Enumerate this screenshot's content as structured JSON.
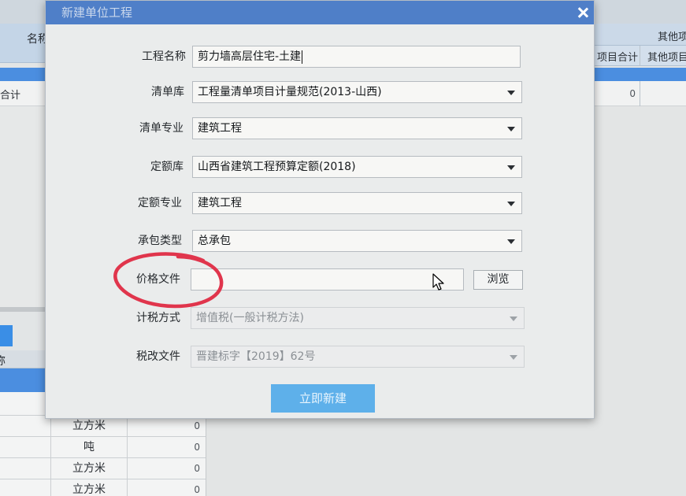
{
  "window": {
    "title": "新建单位工程"
  },
  "icons": {
    "close": "close-icon",
    "dropdown": "chevron-down-icon",
    "pointer": "mouse-pointer-icon"
  },
  "colors": {
    "title_bar": "#4f7fc8",
    "selected_row": "#4b8ee0",
    "submit_button": "#5eb0ea",
    "annotation": "#e0354c"
  },
  "form": {
    "fields": [
      {
        "label": "工程名称",
        "type": "text",
        "value": "剪力墙高层住宅-土建",
        "enabled": true
      },
      {
        "label": "清单库",
        "type": "select",
        "value": "工程量清单项目计量规范(2013-山西)",
        "enabled": true
      },
      {
        "label": "清单专业",
        "type": "select",
        "value": "建筑工程",
        "enabled": true
      },
      {
        "label": "定额库",
        "type": "select",
        "value": "山西省建筑工程预算定额(2018)",
        "enabled": true
      },
      {
        "label": "定额专业",
        "type": "select",
        "value": "建筑工程",
        "enabled": true
      },
      {
        "label": "承包类型",
        "type": "select",
        "value": "总承包",
        "enabled": true
      },
      {
        "label": "价格文件",
        "type": "file",
        "value": "",
        "enabled": true
      },
      {
        "label": "计税方式",
        "type": "select",
        "value": "增值税(一般计税方法)",
        "enabled": false
      },
      {
        "label": "税改文件",
        "type": "select",
        "value": "晋建标字【2019】62号",
        "enabled": false
      }
    ],
    "browse_label": "浏览",
    "submit_label": "立即新建"
  },
  "background_app": {
    "grid_left": {
      "header": "名称",
      "total_row": "合计",
      "lower_header": "称"
    },
    "grid_right": {
      "header_top": "其他项",
      "header_cols": [
        "项目合计",
        "其他项目"
      ],
      "total_value": "0"
    },
    "lower_rows": [
      {
        "unit": "立方米",
        "value": "0"
      },
      {
        "unit": "吨",
        "value": "0"
      },
      {
        "unit": "立方米",
        "value": "0"
      },
      {
        "unit": "立方米",
        "value": "0"
      }
    ]
  }
}
